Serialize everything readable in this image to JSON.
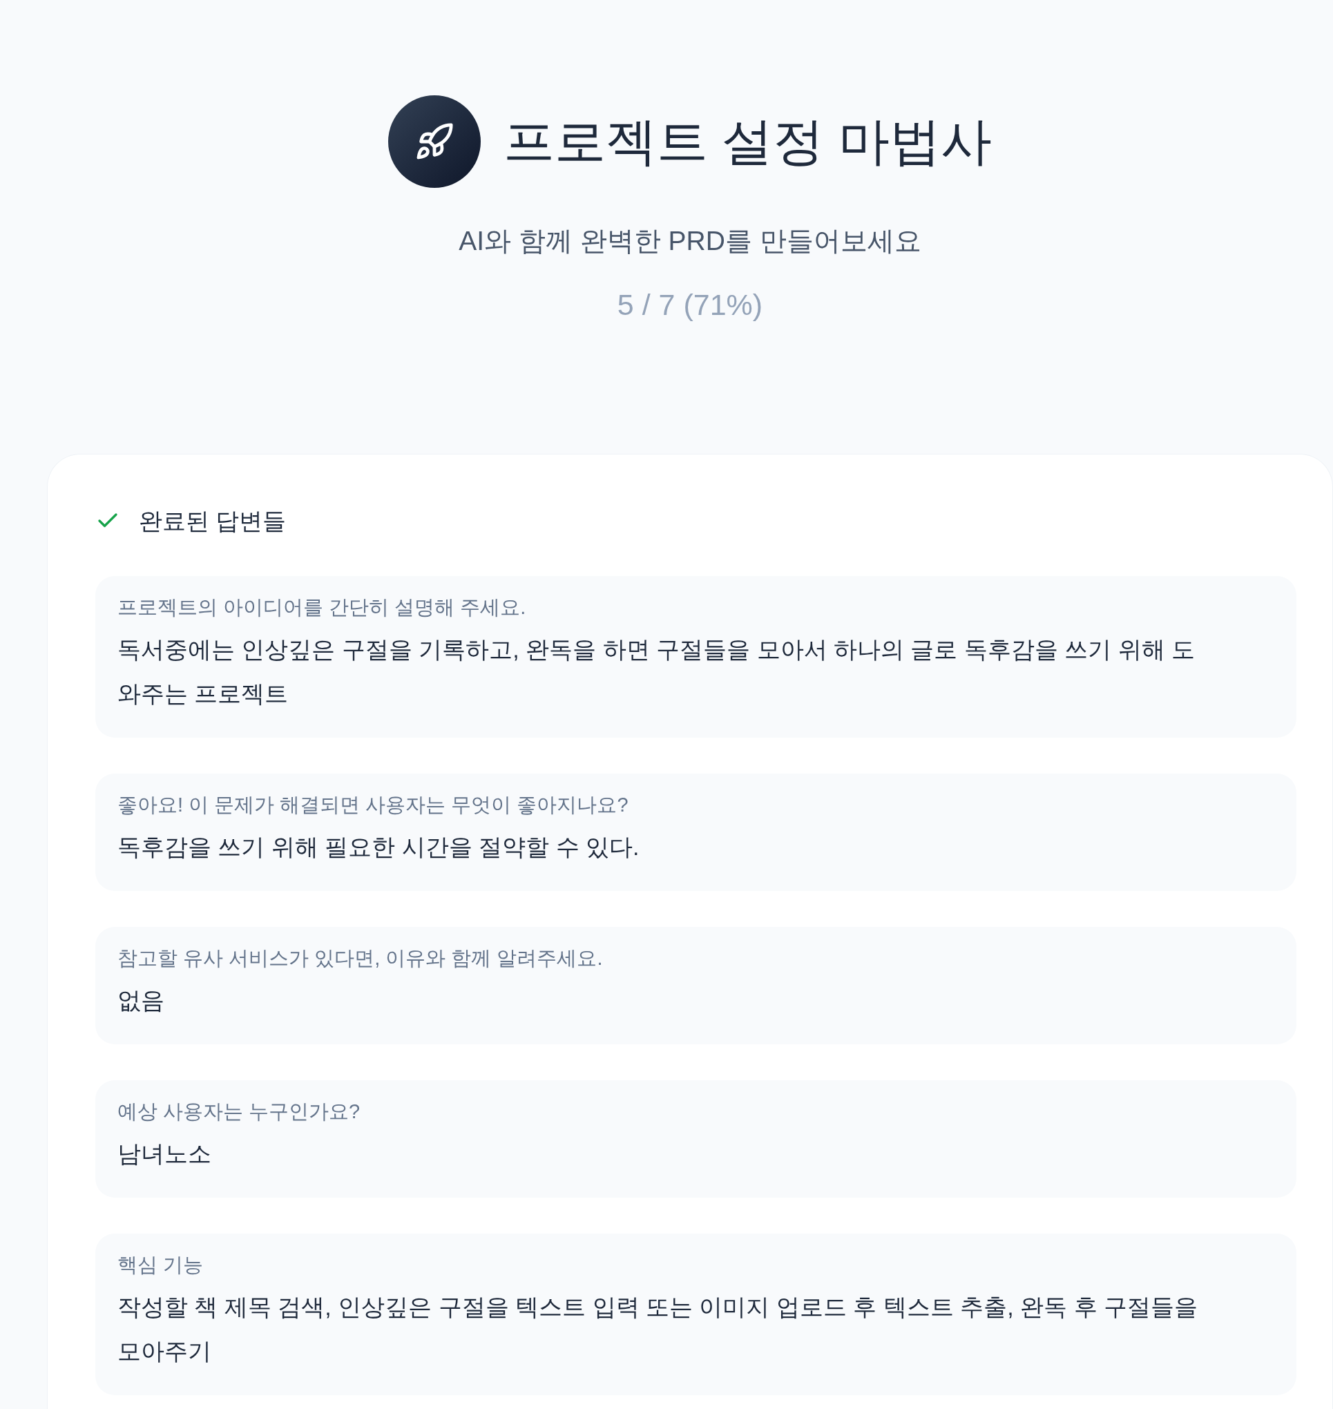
{
  "header": {
    "title": "프로젝트 설정 마법사",
    "subtitle": "AI와 함께 완벽한 PRD를 만들어보세요",
    "progress": "5 / 7 (71%)"
  },
  "completed_section": {
    "title": "완료된 답변들",
    "answers": [
      {
        "question": "프로젝트의 아이디어를 간단히 설명해 주세요.",
        "answer": "독서중에는 인상깊은 구절을 기록하고, 완독을 하면 구절들을 모아서 하나의 글로 독후감을 쓰기 위해 도와주는 프로젝트"
      },
      {
        "question": "좋아요! 이 문제가 해결되면 사용자는 무엇이 좋아지나요?",
        "answer": "독후감을 쓰기 위해 필요한 시간을 절약할 수 있다."
      },
      {
        "question": "참고할 유사 서비스가 있다면, 이유와 함께 알려주세요.",
        "answer": "없음"
      },
      {
        "question": "예상 사용자는 누구인가요?",
        "answer": "남녀노소"
      },
      {
        "question": "핵심 기능",
        "answer": "작성할 책 제목 검색, 인상깊은 구절을 텍스트 입력 또는 이미지 업로드 후 텍스트 추출, 완독 후 구절들을 모아주기"
      }
    ]
  }
}
